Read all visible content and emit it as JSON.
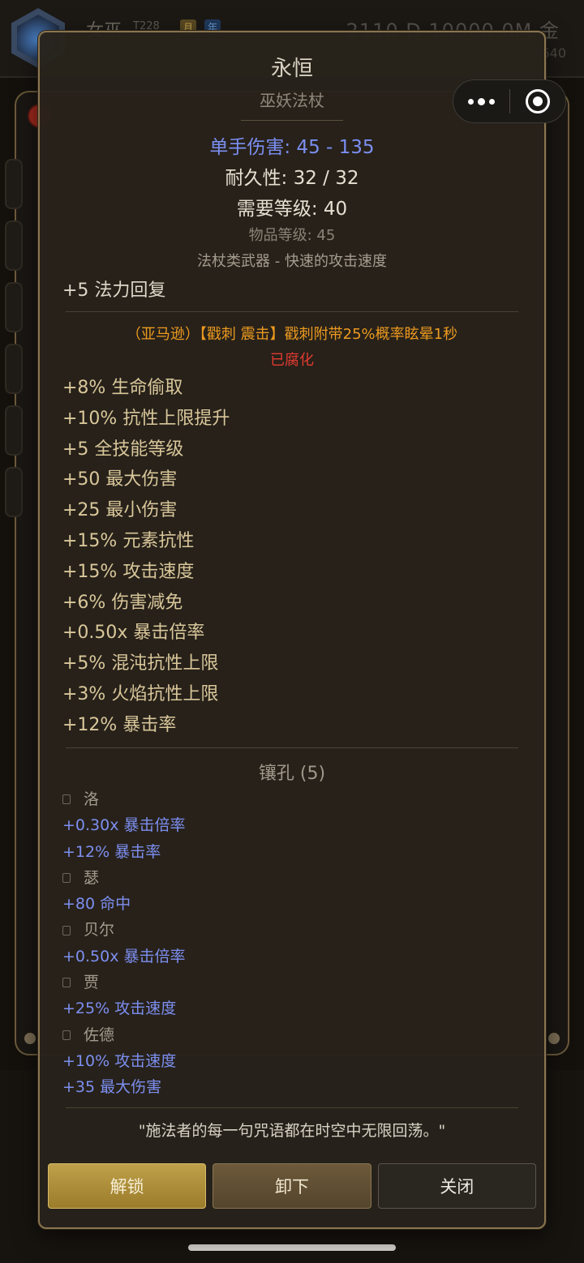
{
  "background": {
    "player_name": "女巫",
    "level": "T228",
    "tags": [
      "月",
      "年"
    ],
    "currency": "2110 D   10000.0M 金",
    "sub_value": "640"
  },
  "item": {
    "name": "永恒",
    "type": "巫妖法杖",
    "damage": "单手伤害: 45 - 135",
    "durability": "耐久性: 32 / 32",
    "required_level": "需要等级: 40",
    "item_level": "物品等级: 45",
    "weapon_class": "法杖类武器 - 快速的攻击速度",
    "base_mod": "+5 法力回复",
    "legendary_affix": "（亚马逊）【戳刺 震击】戳刺附带25%概率眩晕1秒",
    "corrupted": "已腐化",
    "mods": [
      "+8% 生命偷取",
      "+10% 抗性上限提升",
      "+5 全技能等级",
      "+50 最大伤害",
      "+25 最小伤害",
      "+15% 元素抗性",
      "+15% 攻击速度",
      "+6% 伤害减免",
      "+0.50x 暴击倍率",
      "+5% 混沌抗性上限",
      "+3% 火焰抗性上限",
      "+12% 暴击率"
    ],
    "sockets_title": "镶孔 (5)",
    "runes": [
      {
        "name": "洛",
        "stats": [
          "+0.30x 暴击倍率",
          "+12% 暴击率"
        ]
      },
      {
        "name": "瑟",
        "stats": [
          "+80 命中"
        ]
      },
      {
        "name": "贝尔",
        "stats": [
          "+0.50x 暴击倍率"
        ]
      },
      {
        "name": "贾",
        "stats": [
          "+25% 攻击速度"
        ]
      },
      {
        "name": "佐德",
        "stats": [
          "+10% 攻击速度",
          "+35 最大伤害"
        ]
      }
    ],
    "quote": "\"施法者的每一句咒语都在时空中无限回荡。\""
  },
  "buttons": {
    "unlock": "解锁",
    "unequip": "卸下",
    "close": "关闭"
  },
  "colors": {
    "damage_blue": "#7b8ff0",
    "legendary_orange": "#ec9a1f",
    "corrupted_red": "#e23b30",
    "mod_gold": "#d9c79a",
    "unlock_gold": "#bfa04a"
  }
}
